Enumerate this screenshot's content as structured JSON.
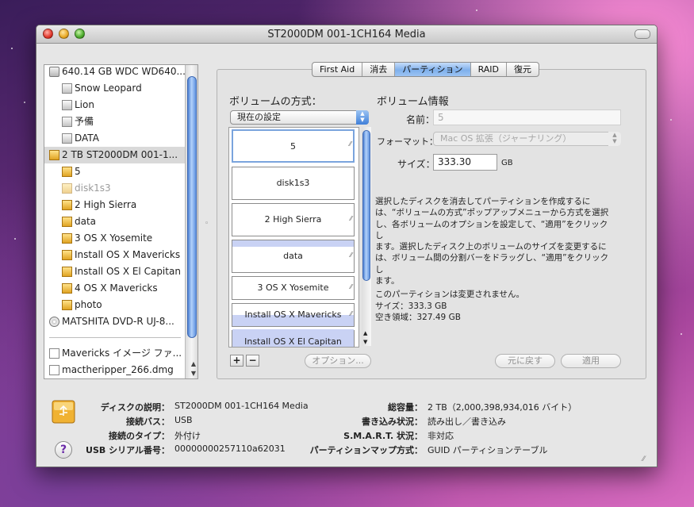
{
  "window": {
    "title": "ST2000DM 001-1CH164 Media"
  },
  "sidebar": {
    "items": [
      {
        "label": "640.14 GB WDC WD640...",
        "icon": "hard-disk-icon"
      },
      {
        "label": "Snow Leopard",
        "icon": "volume-icon"
      },
      {
        "label": "Lion",
        "icon": "volume-icon"
      },
      {
        "label": "予備",
        "icon": "volume-icon"
      },
      {
        "label": "DATA",
        "icon": "volume-icon"
      },
      {
        "label": "2 TB ST2000DM 001-1...",
        "icon": "usb-disk-icon"
      },
      {
        "label": "5",
        "icon": "usb-volume-icon"
      },
      {
        "label": "disk1s3",
        "icon": "usb-volume-icon"
      },
      {
        "label": "2 High Sierra",
        "icon": "usb-volume-icon"
      },
      {
        "label": "data",
        "icon": "usb-volume-icon"
      },
      {
        "label": "3 OS X Yosemite",
        "icon": "usb-volume-icon"
      },
      {
        "label": "Install OS X Mavericks",
        "icon": "usb-volume-icon"
      },
      {
        "label": "Install OS X El Capitan",
        "icon": "usb-volume-icon"
      },
      {
        "label": "4 OS X Mavericks",
        "icon": "usb-volume-icon"
      },
      {
        "label": "photo",
        "icon": "usb-volume-icon"
      },
      {
        "label": "MATSHITA DVD-R UJ-8...",
        "icon": "dvd-icon"
      },
      {
        "label": "Mavericks イメージ ファ...",
        "icon": "disk-image-icon"
      },
      {
        "label": "mactheripper_266.dmg",
        "icon": "disk-image-icon"
      }
    ]
  },
  "tabs": [
    {
      "label": "First Aid"
    },
    {
      "label": "消去"
    },
    {
      "label": "パーティション"
    },
    {
      "label": "RAID"
    },
    {
      "label": "復元"
    }
  ],
  "partition": {
    "scheme_label": "ボリュームの方式：",
    "scheme_value": "現在の設定",
    "volume_info_label": "ボリューム情報",
    "name_label": "名前：",
    "name_value": "5",
    "format_label": "フォーマット：",
    "format_value": "Mac OS 拡張（ジャーナリング）",
    "size_label": "サイズ：",
    "size_value": "333.30",
    "size_unit": "GB",
    "volumes": [
      {
        "label": "5"
      },
      {
        "label": "disk1s3"
      },
      {
        "label": "2 High Sierra"
      },
      {
        "label": "data"
      },
      {
        "label": "3 OS X Yosemite"
      },
      {
        "label": "Install OS X Mavericks"
      },
      {
        "label": "Install OS X El Capitan"
      }
    ],
    "add_label": "+",
    "remove_label": "−",
    "options_label": "オプション...",
    "revert_label": "元に戻す",
    "apply_label": "適用",
    "description_lines": [
      "選択したディスクを消去してパーティションを作成するに",
      "は、“ボリュームの方式”ポップアップメニューから方式を選択",
      "し、各ボリュームのオプションを設定して、“適用”をクリックし",
      "ます。選択したディスク上のボリュームのサイズを変更するに",
      "は、ボリューム間の分割バーをドラッグし、“適用”をクリックし",
      "ます。"
    ],
    "status_line": "このパーティションは変更されません。",
    "size_line": "サイズ：333.3 GB",
    "free_line": "空き領域：327.49 GB"
  },
  "info": {
    "description_label": "ディスクの説明：",
    "description_value": "ST2000DM 001-1CH164 Media",
    "bus_label": "接続バス：",
    "bus_value": "USB",
    "type_label": "接続のタイプ：",
    "type_value": "外付け",
    "serial_label": "USB シリアル番号：",
    "serial_value": "00000000257110a62031",
    "capacity_label": "総容量：",
    "capacity_value": "2 TB（2,000,398,934,016 バイト）",
    "write_label": "書き込み状況：",
    "write_value": "読み出し／書き込み",
    "smart_label": "S.M.A.R.T. 状況：",
    "smart_value": "非対応",
    "map_label": "パーティションマップ方式：",
    "map_value": "GUID パーティションテーブル",
    "help_label": "?"
  }
}
